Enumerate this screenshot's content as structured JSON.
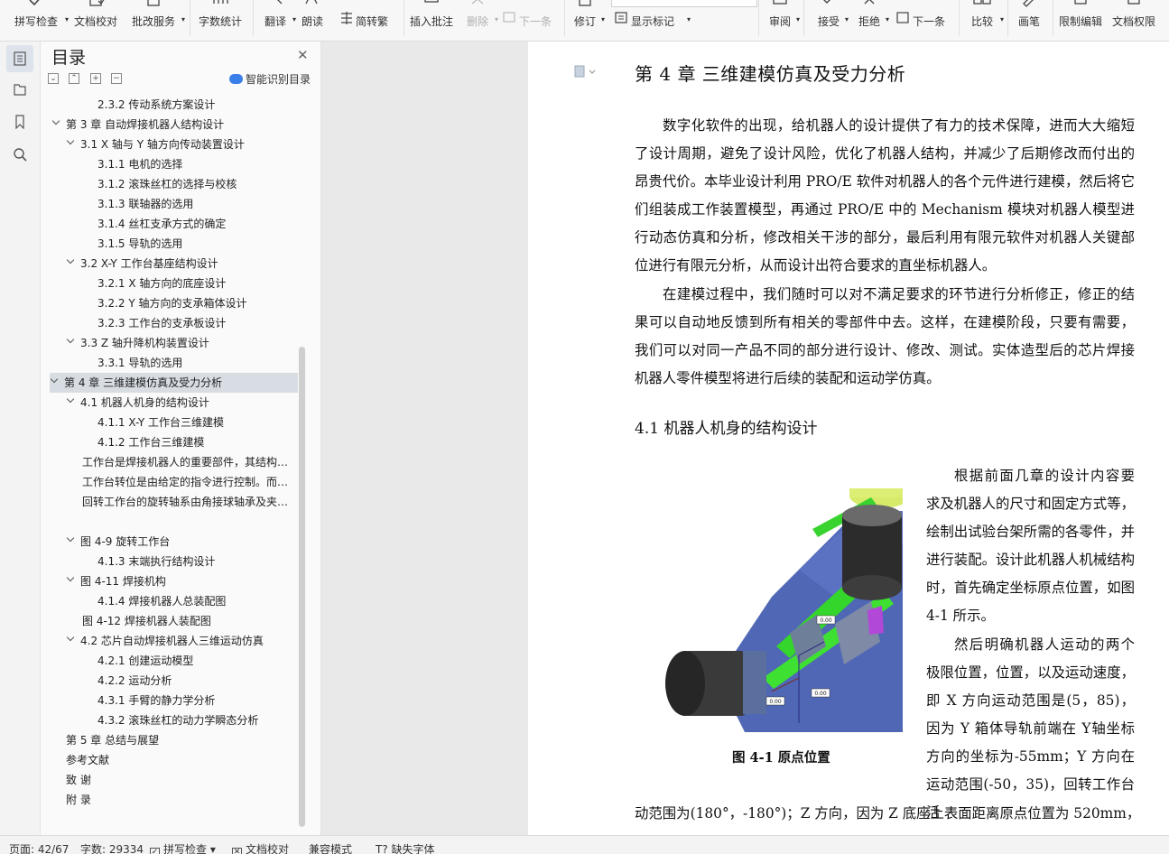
{
  "ribbon": {
    "items": [
      {
        "label": "拼写检查",
        "dd": true
      },
      {
        "label": "文档校对"
      },
      {
        "label": "批改服务",
        "dd": true
      },
      {
        "label": "字数统计"
      },
      {
        "label": "翻译",
        "dd": true
      },
      {
        "label": "朗读"
      },
      {
        "label": "简转繁"
      },
      {
        "label": "插入批注"
      },
      {
        "label": "删除",
        "dd": true
      },
      {
        "label": "下一条"
      },
      {
        "label": "修订",
        "dd": true
      },
      {
        "label": "显示标记",
        "dd": true
      },
      {
        "label": "审阅",
        "dd": true
      },
      {
        "label": "接受",
        "dd": true
      },
      {
        "label": "拒绝",
        "dd": true
      },
      {
        "label": "下一条"
      },
      {
        "label": "比较",
        "dd": true
      },
      {
        "label": "画笔"
      },
      {
        "label": "限制编辑"
      },
      {
        "label": "文档权限"
      }
    ]
  },
  "toc": {
    "title": "目录",
    "smart_label": "智能识别目录",
    "items": [
      {
        "text": "2.3.2  传动系统方案设计",
        "level": 3
      },
      {
        "text": "第 3 章   自动焊接机器人结构设计",
        "level": 1,
        "expanded": true
      },
      {
        "text": "3.1 X 轴与 Y 轴方向传动装置设计",
        "level": 2,
        "expanded": true
      },
      {
        "text": "3.1.1  电机的选择",
        "level": 3
      },
      {
        "text": "3.1.2 滚珠丝杠的选择与校核",
        "level": 3
      },
      {
        "text": "3.1.3  联轴器的选用",
        "level": 3
      },
      {
        "text": "3.1.4  丝杠支承方式的确定",
        "level": 3
      },
      {
        "text": "3.1.5  导轨的选用",
        "level": 3
      },
      {
        "text": "3.2    X-Y 工作台基座结构设计",
        "level": 2,
        "expanded": true
      },
      {
        "text": "3.2.1    X 轴方向的底座设计",
        "level": 3
      },
      {
        "text": "3.2.2    Y 轴方向的支承箱体设计",
        "level": 3
      },
      {
        "text": "3.2.3    工作台的支承板设计",
        "level": 3
      },
      {
        "text": "3.3    Z 轴升降机构装置设计",
        "level": 2,
        "expanded": true
      },
      {
        "text": "3.3.1  导轨的选用",
        "level": 3
      },
      {
        "text": "第 4 章  三维建模仿真及受力分析",
        "level": 1,
        "expanded": true,
        "selected": true
      },
      {
        "text": "4.1  机器人机身的结构设计",
        "level": 2,
        "expanded": true
      },
      {
        "text": "4.1.1    X-Y 工作台三维建模",
        "level": 3
      },
      {
        "text": "4.1.2    工作台三维建模",
        "level": 3
      },
      {
        "text": "工作台是焊接机器人的重要部件，其结构设计...",
        "level": "t"
      },
      {
        "text": "工作台转位是由给定的指令进行控制。而转台...",
        "level": "t"
      },
      {
        "text": "回转工作台的旋转轴系由角接球轴承及夹具组成...",
        "level": "t"
      },
      {
        "text": "",
        "level": "t"
      },
      {
        "text": "图 4-9      旋转工作台",
        "level": 2,
        "expanded": true
      },
      {
        "text": "4.1.3    末端执行结构设计",
        "level": 3
      },
      {
        "text": "图 4-11      焊接机构",
        "level": 2,
        "expanded": true
      },
      {
        "text": "4.1.4    焊接机器人总装配图",
        "level": 3
      },
      {
        "text": "图 4-12      焊接机器人装配图",
        "level": "t"
      },
      {
        "text": "4.2  芯片自动焊接机器人三维运动仿真",
        "level": 2,
        "expanded": true
      },
      {
        "text": "4.2.1  创建运动模型",
        "level": 3
      },
      {
        "text": "4.2.2  运动分析",
        "level": 3
      },
      {
        "text": "4.3.1  手臂的静力学分析",
        "level": 3
      },
      {
        "text": "4.3.2  滚珠丝杠的动力学瞬态分析",
        "level": 3
      },
      {
        "text": "第 5 章  总结与展望",
        "level": 1
      },
      {
        "text": "参考文献",
        "level": 1
      },
      {
        "text": "致    谢",
        "level": 1
      },
      {
        "text": "附    录",
        "level": 1
      }
    ]
  },
  "document": {
    "chapter_title": "第 4 章  三维建模仿真及受力分析",
    "para1": "数字化软件的出现，给机器人的设计提供了有力的技术保障，进而大大缩短了设计周期，避免了设计风险，优化了机器人结构，并减少了后期修改而付出的昂贵代价。本毕业设计利用 PRO/E 软件对机器人的各个元件进行建模，然后将它们组装成工作装置模型，再通过 PRO/E 中的 Mechanism 模块对机器人模型进行动态仿真和分析，修改相关干涉的部分，最后利用有限元软件对机器人关键部位进行有限元分析，从而设计出符合要求的直坐标机器人。",
    "para2": "在建模过程中，我们随时可以对不满足要求的环节进行分析修正，修正的结果可以自动地反馈到所有相关的零部件中去。这样，在建模阶段，只要有需要，我们可以对同一产品不同的部分进行设计、修改、测试。实体造型后的芯片焊接机器人零件模型将进行后续的装配和运动学仿真。",
    "section_title": "4.1  机器人机身的结构设计",
    "side1": "根据前面几章的设计内容要求及机器人的尺寸和固定方式等，绘制出试验台架所需的各零件，并进行装配。设计此机器人机械结构时，首先确定坐标原点位置，如图 4-1 所示。",
    "side2": "然后明确机器人运动的两个极限位置，位置，以及运动速度，即 X 方向运动范围是(5，85)，因为 Y 箱体导轨前端在 Y轴坐标方向的坐标为-55mm；Y 方向在运动范围(-50，35)，回转工作台活",
    "bottom_line": "动范围为(180°，-180°)；Z 方向，因为 Z 底座上表面距离原点位置为 520mm，",
    "figure_caption": "图 4-1    原点位置",
    "figure_tags": [
      "0.00",
      "0.00",
      "0.00"
    ]
  },
  "status": {
    "page": "页面: 42/67",
    "words": "字数: 29334",
    "spell": "拼写检查",
    "proof": "文档校对",
    "compat": "兼容模式",
    "missing_font": "缺失字体"
  },
  "colors": {
    "accent": "#3a7ee8",
    "toc_selected": "#d8dde4",
    "workspace": "#e9e9e9"
  }
}
